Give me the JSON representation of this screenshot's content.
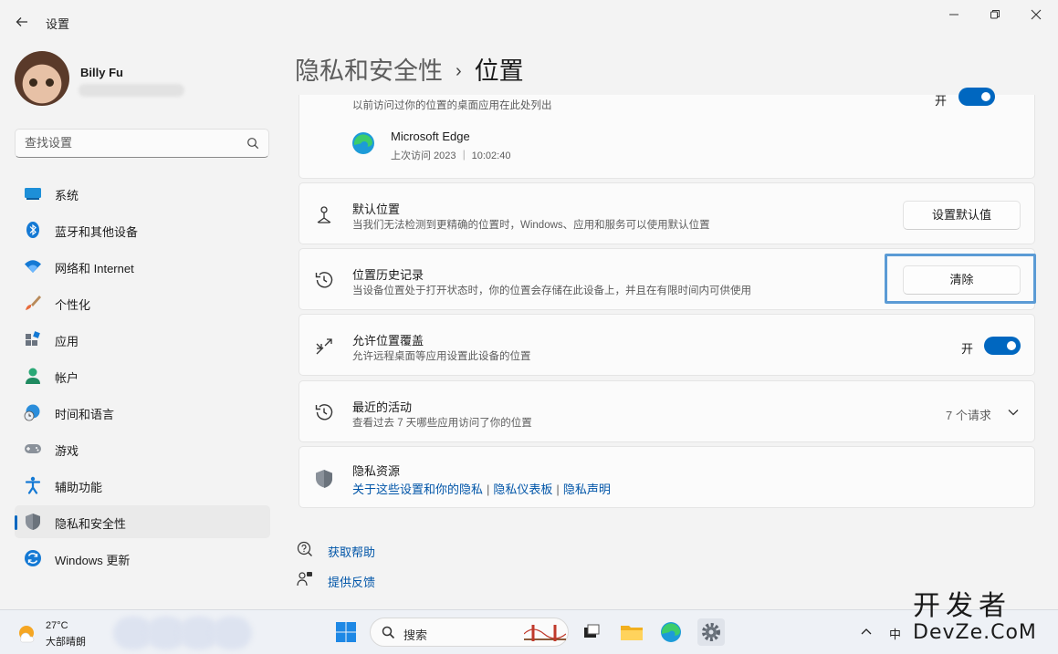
{
  "window": {
    "title": "设置",
    "back_icon": "back-arrow-icon",
    "minimize_label": "—",
    "maximize_label": "▢",
    "close_label": "✕"
  },
  "profile": {
    "name": "Billy Fu"
  },
  "search": {
    "placeholder": "查找设置"
  },
  "sidebar": {
    "items": [
      {
        "label": "系统",
        "icon": "system-icon",
        "active": false
      },
      {
        "label": "蓝牙和其他设备",
        "icon": "bluetooth-icon",
        "active": false
      },
      {
        "label": "网络和 Internet",
        "icon": "wifi-icon",
        "active": false
      },
      {
        "label": "个性化",
        "icon": "brush-icon",
        "active": false
      },
      {
        "label": "应用",
        "icon": "apps-icon",
        "active": false
      },
      {
        "label": "帐户",
        "icon": "account-icon",
        "active": false
      },
      {
        "label": "时间和语言",
        "icon": "globe-clock-icon",
        "active": false
      },
      {
        "label": "游戏",
        "icon": "gamepad-icon",
        "active": false
      },
      {
        "label": "辅助功能",
        "icon": "accessibility-icon",
        "active": false
      },
      {
        "label": "隐私和安全性",
        "icon": "shield-icon",
        "active": true
      },
      {
        "label": "Windows 更新",
        "icon": "update-icon",
        "active": false
      }
    ]
  },
  "breadcrumb": {
    "parent": "隐私和安全性",
    "separator": "›",
    "current": "位置"
  },
  "cards": {
    "recent_apps": {
      "desc": "以前访问过你的位置的桌面应用在此处列出",
      "toggle_label": "开",
      "app_name": "Microsoft Edge",
      "app_last_access": "上次访问 2023 ｜ 10:02:40"
    },
    "default_location": {
      "title": "默认位置",
      "desc": "当我们无法检测到更精确的位置时，Windows、应用和服务可以使用默认位置",
      "button": "设置默认值"
    },
    "location_history": {
      "title": "位置历史记录",
      "desc": "当设备位置处于打开状态时，你的位置会存储在此设备上，并且在有限时间内可供使用",
      "button": "清除"
    },
    "override": {
      "title": "允许位置覆盖",
      "desc": "允许远程桌面等应用设置此设备的位置",
      "toggle_label": "开",
      "toggle_on": true
    },
    "recent_activity": {
      "title": "最近的活动",
      "desc": "查看过去 7 天哪些应用访问了你的位置",
      "count": "7 个请求"
    },
    "privacy_resources": {
      "title": "隐私资源",
      "links": [
        "关于这些设置和你的隐私",
        "隐私仪表板",
        "隐私声明"
      ],
      "link_separator": "|"
    }
  },
  "help": {
    "get_help": "获取帮助",
    "feedback": "提供反馈"
  },
  "taskbar": {
    "weather_temp": "27°C",
    "weather_desc": "大部晴朗",
    "search_label": "搜索",
    "tray_chevron": "^",
    "ime_label": "中"
  },
  "watermark": {
    "cn": "开发者",
    "en": "DevZe.CoM"
  },
  "colors": {
    "accent": "#0067c0",
    "link": "#0055a8",
    "focus": "#5b9bd5"
  }
}
